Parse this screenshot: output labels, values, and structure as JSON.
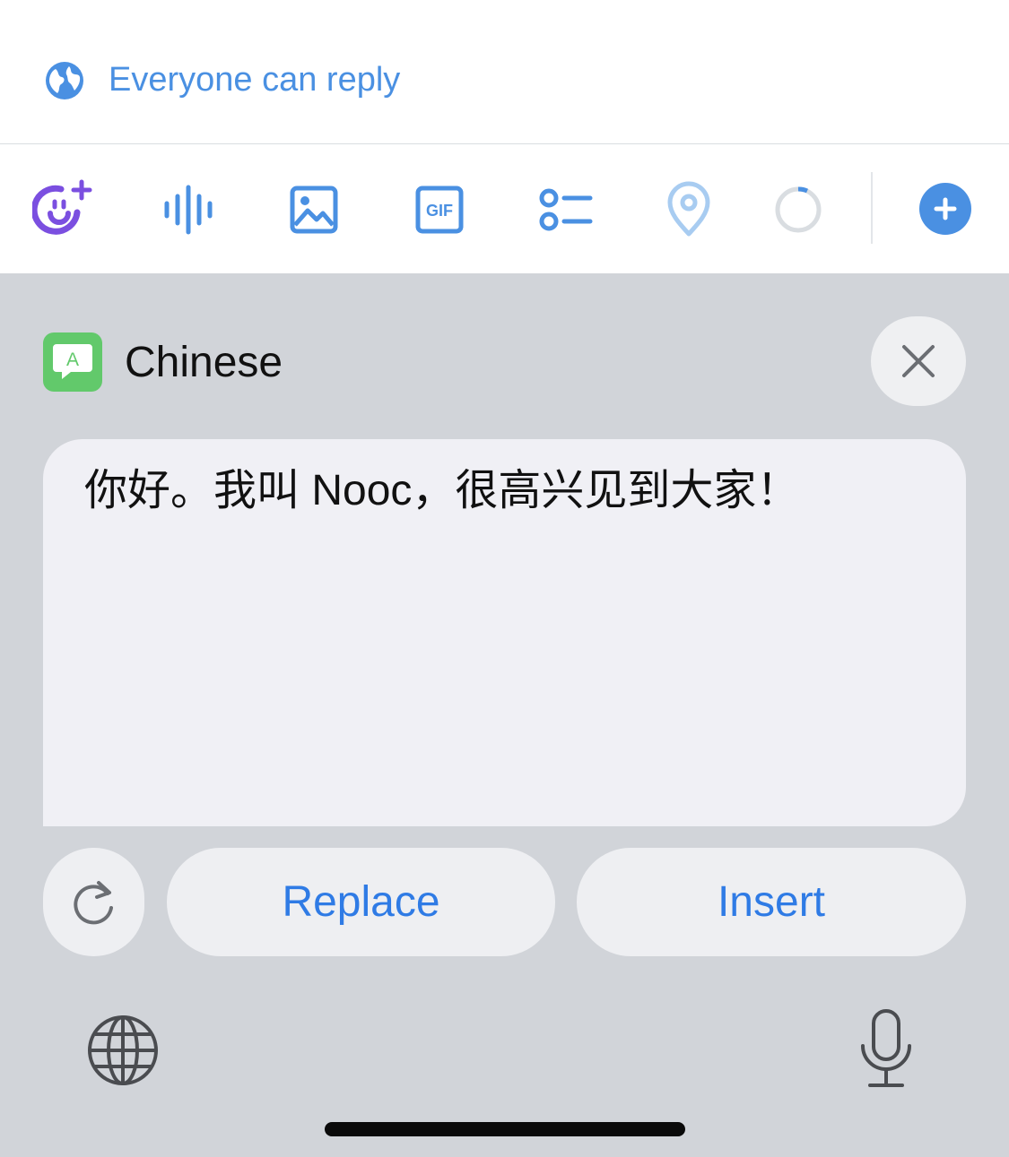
{
  "reply_setting": {
    "label": "Everyone can reply",
    "icon": "globe-icon"
  },
  "toolbar": {
    "icons": [
      "spaces-add-icon",
      "audio-waveform-icon",
      "image-icon",
      "gif-icon",
      "poll-icon",
      "location-icon",
      "character-count-ring-icon"
    ],
    "gif_label": "GIF",
    "add_icon": "plus-icon"
  },
  "translate_panel": {
    "language": "Chinese",
    "badge_letter": "A",
    "translated_text": "你好。我叫 Nooc，很高兴见到大家！",
    "replace_label": "Replace",
    "insert_label": "Insert"
  },
  "colors": {
    "accent": "#4a90e2",
    "button_text": "#2f7be5",
    "spaces_purple": "#7b4fe0",
    "badge_green": "#62c96b",
    "panel_bg": "#d1d4d9"
  }
}
